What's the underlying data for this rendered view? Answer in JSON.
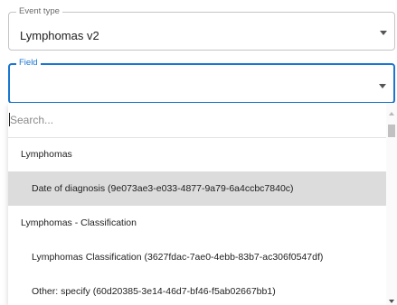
{
  "event_type": {
    "label": "Event type",
    "value": "Lymphomas v2"
  },
  "field": {
    "label": "Field",
    "value": ""
  },
  "dropdown": {
    "search_placeholder": "Search...",
    "items": [
      {
        "kind": "group",
        "label": "Lymphomas"
      },
      {
        "kind": "option",
        "label": "Date of diagnosis (9e073ae3-e033-4877-9a79-6a4ccbc7840c)",
        "selected": true
      },
      {
        "kind": "group",
        "label": "Lymphomas - Classification"
      },
      {
        "kind": "option",
        "label": "Lymphomas Classification (3627fdac-7ae0-4ebb-83b7-ac306f0547df)",
        "selected": false
      },
      {
        "kind": "option",
        "label": "Other: specify (60d20385-3e14-46d7-bf46-f5ab02667bb1)",
        "selected": false
      }
    ]
  },
  "colors": {
    "accent": "#1976d2",
    "selected_bg": "#dcdcdc",
    "border": "#c4c4c4"
  },
  "icons": {
    "dropdown_caret": "chevron-down-icon",
    "scroll_up": "scroll-up-arrow-icon",
    "scroll_down": "scroll-down-arrow-icon"
  }
}
